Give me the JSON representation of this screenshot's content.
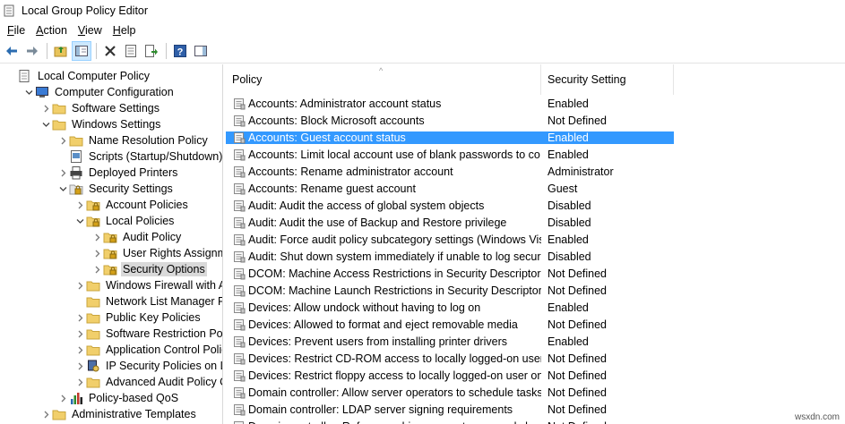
{
  "window": {
    "title": "Local Group Policy Editor"
  },
  "menu": [
    {
      "label": "File",
      "accel": "F",
      "rest": "ile"
    },
    {
      "label": "Action",
      "accel": "A",
      "rest": "ction"
    },
    {
      "label": "View",
      "accel": "V",
      "rest": "iew"
    },
    {
      "label": "Help",
      "accel": "H",
      "rest": "elp"
    }
  ],
  "toolbar": {
    "buttons": [
      "back-icon",
      "forward-icon",
      "up-folder-icon",
      "show-hide-tree-icon",
      "delete-icon",
      "properties-icon",
      "export-list-icon",
      "help-icon",
      "show-hide-action-pane-icon"
    ]
  },
  "tree": [
    {
      "label": "Local Computer Policy",
      "level": 0,
      "arrow": "",
      "icon": "computer-policy-icon"
    },
    {
      "label": "Computer Configuration",
      "level": 1,
      "arrow": "down",
      "icon": "computer-icon"
    },
    {
      "label": "Software Settings",
      "level": 2,
      "arrow": "right",
      "icon": "folder-icon"
    },
    {
      "label": "Windows Settings",
      "level": 2,
      "arrow": "down",
      "icon": "folder-icon"
    },
    {
      "label": "Name Resolution Policy",
      "level": 3,
      "arrow": "right",
      "icon": "folder-icon"
    },
    {
      "label": "Scripts (Startup/Shutdown)",
      "level": 3,
      "arrow": "",
      "icon": "script-icon"
    },
    {
      "label": "Deployed Printers",
      "level": 3,
      "arrow": "right",
      "icon": "printer-icon"
    },
    {
      "label": "Security Settings",
      "level": 3,
      "arrow": "down",
      "icon": "security-icon"
    },
    {
      "label": "Account Policies",
      "level": 4,
      "arrow": "right",
      "icon": "lock-folder-icon"
    },
    {
      "label": "Local Policies",
      "level": 4,
      "arrow": "down",
      "icon": "lock-folder-icon"
    },
    {
      "label": "Audit Policy",
      "level": 5,
      "arrow": "right",
      "icon": "lock-folder-icon"
    },
    {
      "label": "User Rights Assignment",
      "level": 5,
      "arrow": "right",
      "icon": "lock-folder-icon"
    },
    {
      "label": "Security Options",
      "level": 5,
      "arrow": "right",
      "icon": "lock-folder-icon",
      "selected": true
    },
    {
      "label": "Windows Firewall with Adva",
      "level": 4,
      "arrow": "right",
      "icon": "folder-icon"
    },
    {
      "label": "Network List Manager Polici",
      "level": 4,
      "arrow": "",
      "icon": "folder-icon"
    },
    {
      "label": "Public Key Policies",
      "level": 4,
      "arrow": "right",
      "icon": "folder-icon"
    },
    {
      "label": "Software Restriction Policies",
      "level": 4,
      "arrow": "right",
      "icon": "folder-icon"
    },
    {
      "label": "Application Control Policies",
      "level": 4,
      "arrow": "right",
      "icon": "folder-icon"
    },
    {
      "label": "IP Security Policies on Local",
      "level": 4,
      "arrow": "right",
      "icon": "ipsec-icon"
    },
    {
      "label": "Advanced Audit Policy Conf",
      "level": 4,
      "arrow": "right",
      "icon": "folder-icon"
    },
    {
      "label": "Policy-based QoS",
      "level": 3,
      "arrow": "right",
      "icon": "qos-chart-icon"
    },
    {
      "label": "Administrative Templates",
      "level": 2,
      "arrow": "right",
      "icon": "folder-icon"
    }
  ],
  "list": {
    "headers": {
      "policy": "Policy",
      "setting": "Security Setting"
    },
    "rows": [
      {
        "policy": "Accounts: Administrator account status",
        "setting": "Enabled"
      },
      {
        "policy": "Accounts: Block Microsoft accounts",
        "setting": "Not Defined"
      },
      {
        "policy": "Accounts: Guest account status",
        "setting": "Enabled",
        "selected": true
      },
      {
        "policy": "Accounts: Limit local account use of blank passwords to co...",
        "setting": "Enabled"
      },
      {
        "policy": "Accounts: Rename administrator account",
        "setting": "Administrator"
      },
      {
        "policy": "Accounts: Rename guest account",
        "setting": "Guest"
      },
      {
        "policy": "Audit: Audit the access of global system objects",
        "setting": "Disabled"
      },
      {
        "policy": "Audit: Audit the use of Backup and Restore privilege",
        "setting": "Disabled"
      },
      {
        "policy": "Audit: Force audit policy subcategory settings (Windows Vis...",
        "setting": "Enabled"
      },
      {
        "policy": "Audit: Shut down system immediately if unable to log secur...",
        "setting": "Disabled"
      },
      {
        "policy": "DCOM: Machine Access Restrictions in Security Descriptor D...",
        "setting": "Not Defined"
      },
      {
        "policy": "DCOM: Machine Launch Restrictions in Security Descriptor ...",
        "setting": "Not Defined"
      },
      {
        "policy": "Devices: Allow undock without having to log on",
        "setting": "Enabled"
      },
      {
        "policy": "Devices: Allowed to format and eject removable media",
        "setting": "Not Defined"
      },
      {
        "policy": "Devices: Prevent users from installing printer drivers",
        "setting": "Enabled"
      },
      {
        "policy": "Devices: Restrict CD-ROM access to locally logged-on user ...",
        "setting": "Not Defined"
      },
      {
        "policy": "Devices: Restrict floppy access to locally logged-on user only",
        "setting": "Not Defined"
      },
      {
        "policy": "Domain controller: Allow server operators to schedule tasks",
        "setting": "Not Defined"
      },
      {
        "policy": "Domain controller: LDAP server signing requirements",
        "setting": "Not Defined"
      },
      {
        "policy": "Domain controller: Refuse machine account password chan...",
        "setting": "Not Defined"
      }
    ]
  },
  "watermark": "wsxdn.com"
}
